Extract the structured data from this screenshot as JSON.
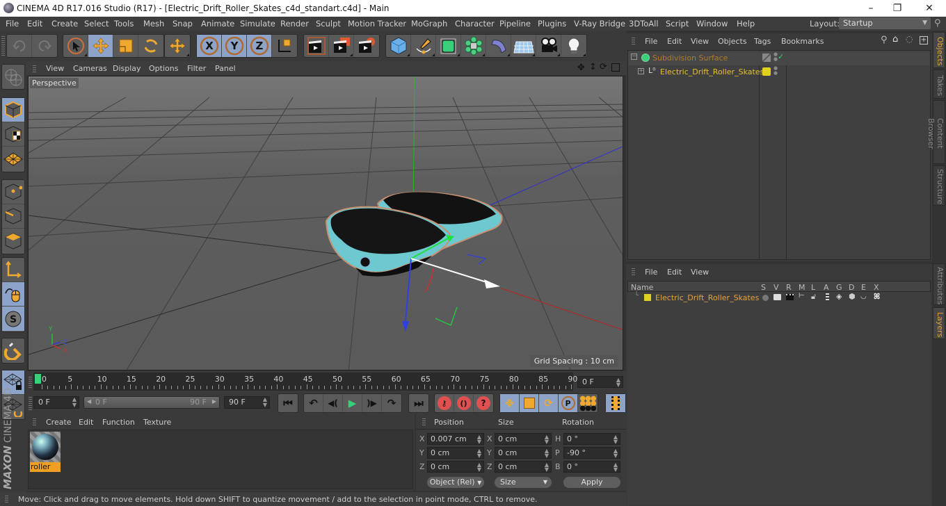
{
  "window": {
    "title": "CINEMA 4D R17.016 Studio (R17) - [Electric_Drift_Roller_Skates_c4d_standart.c4d] - Main",
    "minimize": "–",
    "maximize": "❐",
    "close": "✕"
  },
  "menubar": {
    "items": [
      "File",
      "Edit",
      "Create",
      "Select",
      "Tools",
      "Mesh",
      "Snap",
      "Animate",
      "Simulate",
      "Render",
      "Sculpt",
      "Motion Tracker",
      "MoGraph",
      "Character",
      "Pipeline",
      "Plugins",
      "V-Ray Bridge",
      "3DToAll",
      "Script",
      "Window",
      "Help"
    ],
    "layout_label": "Layout:",
    "layout_value": "Startup"
  },
  "toolbar": {
    "groups": [
      [
        "undo-icon",
        "redo-icon"
      ],
      [
        "live-selection-icon",
        "move-icon",
        "scale-icon",
        "rotate-icon"
      ],
      [
        "recent-tools-icon"
      ],
      [
        "x-axis-lock-icon",
        "y-axis-lock-icon",
        "z-axis-lock-icon",
        "coordinate-system-icon"
      ],
      [
        "render-view-icon",
        "render-to-picture-viewer-icon",
        "render-settings-icon"
      ],
      [
        "cube-primitive-icon",
        "pen-spline-icon",
        "subdivision-surface-icon",
        "cloner-icon",
        "deformer-bend-icon",
        "floor-icon",
        "camera-icon",
        "light-icon"
      ]
    ],
    "active": [
      "move-icon",
      "x-axis-lock-icon",
      "y-axis-lock-icon",
      "z-axis-lock-icon"
    ]
  },
  "lefttools": {
    "items": [
      "make-editable-icon",
      "model-mode-icon",
      "texture-mode-icon",
      "workplane-mode-icon",
      "points-mode-icon",
      "edges-mode-icon",
      "polygons-mode-icon",
      "axis-mode-icon",
      "tweak-mode-icon",
      "solo-mode-icon",
      "snap-icon",
      "lock-workplane-icon",
      "planar-workplane-icon"
    ]
  },
  "viewport": {
    "menu": [
      "View",
      "Cameras",
      "Display",
      "Options",
      "Filter",
      "Panel"
    ],
    "camera_label": "Perspective",
    "grid_spacing": "Grid Spacing : 10 cm",
    "axis_labels": {
      "x": "X",
      "y": "Y",
      "z": "Z"
    }
  },
  "timeline": {
    "ticks": [
      "0",
      "5",
      "10",
      "15",
      "20",
      "25",
      "30",
      "35",
      "40",
      "45",
      "50",
      "55",
      "60",
      "65",
      "70",
      "75",
      "80",
      "85",
      "90"
    ],
    "current_frame": "0 F",
    "start_field": "0 F",
    "range_start": "0 F",
    "range_end": "90 F",
    "end_field": "90 F"
  },
  "materials": {
    "menu": [
      "Create",
      "Edit",
      "Function",
      "Texture"
    ],
    "items": [
      {
        "name": "roller"
      }
    ]
  },
  "coordinates": {
    "headers": [
      "Position",
      "Size",
      "Rotation"
    ],
    "rows": [
      {
        "pos_label": "X",
        "pos": "0.007 cm",
        "size_label": "X",
        "size": "0 cm",
        "rot_label": "H",
        "rot": "0 °"
      },
      {
        "pos_label": "Y",
        "pos": "0 cm",
        "size_label": "Y",
        "size": "0 cm",
        "rot_label": "P",
        "rot": "-90 °"
      },
      {
        "pos_label": "Z",
        "pos": "0 cm",
        "size_label": "Z",
        "size": "0 cm",
        "rot_label": "B",
        "rot": "0 °"
      }
    ],
    "mode_select": "Object (Rel)",
    "size_select": "Size",
    "apply": "Apply"
  },
  "status": "Move: Click and drag to move elements. Hold down SHIFT to quantize movement / add to the selection in point mode, CTRL to remove.",
  "branding": {
    "maxon": "MAXON",
    "product": "CINEMA 4D"
  },
  "objects": {
    "menu": [
      "File",
      "Edit",
      "View",
      "Objects",
      "Tags",
      "Bookmarks"
    ],
    "tree": [
      {
        "name": "Subdivision Surface",
        "color": "#b07a2a"
      },
      {
        "name": "Electric_Drift_Roller_Skates",
        "color": "#e8c030"
      }
    ]
  },
  "layers": {
    "menu": [
      "File",
      "Edit",
      "View"
    ],
    "columns": [
      "Name",
      "S",
      "V",
      "R",
      "M",
      "L",
      "A",
      "G",
      "D",
      "E",
      "X"
    ],
    "rows": [
      {
        "name": "Electric_Drift_Roller_Skates",
        "color": "#e0d020"
      }
    ]
  },
  "sidetabs": {
    "top": [
      "Objects",
      "Takes",
      "Content Browser",
      "Structure"
    ],
    "bottom": [
      "Attributes",
      "Layers"
    ]
  },
  "colors": {
    "accent_orange": "#e8a33c",
    "active_blue": "#8da4c8",
    "layer_yellow": "#e0d020"
  }
}
